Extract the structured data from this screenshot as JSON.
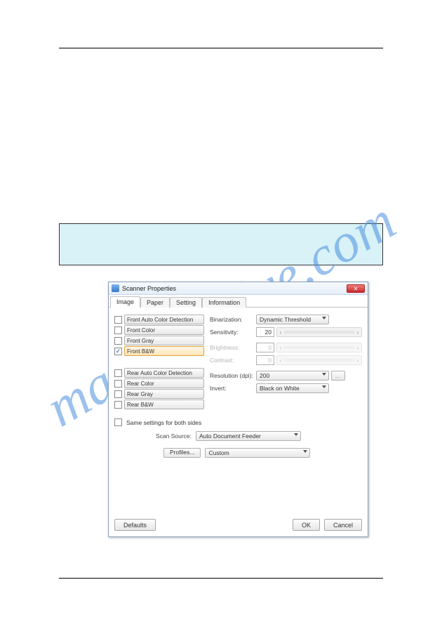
{
  "watermark_text": "manualshive.com",
  "dialog": {
    "title": "Scanner Properties",
    "tabs": [
      "Image",
      "Paper",
      "Setting",
      "Information"
    ],
    "active_tab": 0,
    "image_selection": {
      "front": [
        {
          "label": "Front Auto Color Detection",
          "checked": false,
          "selected": false
        },
        {
          "label": "Front Color",
          "checked": false,
          "selected": false
        },
        {
          "label": "Front Gray",
          "checked": false,
          "selected": false
        },
        {
          "label": "Front B&W",
          "checked": true,
          "selected": true
        }
      ],
      "rear": [
        {
          "label": "Rear Auto Color Detection",
          "checked": false,
          "selected": false
        },
        {
          "label": "Rear Color",
          "checked": false,
          "selected": false
        },
        {
          "label": "Rear Gray",
          "checked": false,
          "selected": false
        },
        {
          "label": "Rear B&W",
          "checked": false,
          "selected": false
        }
      ]
    },
    "binarization": {
      "label": "Binarization:",
      "value": "Dynamic Threshold"
    },
    "sensitivity": {
      "label": "Sensitivity:",
      "value": "20"
    },
    "brightness": {
      "label": "Brightness:",
      "value": "0"
    },
    "contrast": {
      "label": "Contrast:",
      "value": "0"
    },
    "resolution": {
      "label": "Resolution (dpi):",
      "value": "200"
    },
    "invert": {
      "label": "Invert:",
      "value": "Black on White"
    },
    "same_settings": {
      "label": "Same settings for both sides",
      "checked": false
    },
    "scan_source": {
      "label": "Scan Source:",
      "value": "Auto Document Feeder"
    },
    "profiles": {
      "btn": "Profiles...",
      "value": "Custom"
    },
    "buttons": {
      "defaults": "Defaults",
      "ok": "OK",
      "cancel": "Cancel"
    }
  }
}
